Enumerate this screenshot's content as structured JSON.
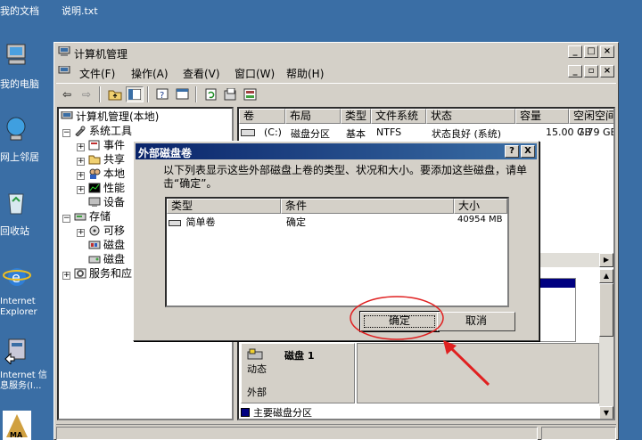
{
  "desktop": {
    "items": [
      {
        "label": "我的文档",
        "icon": "folder-icon"
      },
      {
        "label": "说明.txt",
        "icon": "text-file-icon"
      },
      {
        "label": "我的电脑",
        "icon": "computer-icon"
      },
      {
        "label": "网上邻居",
        "icon": "network-icon"
      },
      {
        "label": "回收站",
        "icon": "recycle-bin-icon"
      },
      {
        "label": "Internet Explorer",
        "icon": "ie-icon"
      },
      {
        "label": "Internet 信息服务(I...",
        "icon": "iis-icon"
      }
    ]
  },
  "window": {
    "title": "计算机管理",
    "menu": [
      "文件(F)",
      "操作(A)",
      "查看(V)",
      "窗口(W)",
      "帮助(H)"
    ],
    "tree": [
      {
        "label": "计算机管理(本地)",
        "indent": 0
      },
      {
        "label": "系统工具",
        "indent": 1
      },
      {
        "label": "事件",
        "indent": 2
      },
      {
        "label": "共享",
        "indent": 2
      },
      {
        "label": "本地",
        "indent": 2
      },
      {
        "label": "性能",
        "indent": 2
      },
      {
        "label": "设备",
        "indent": 2
      },
      {
        "label": "存储",
        "indent": 1
      },
      {
        "label": "可移",
        "indent": 2
      },
      {
        "label": "磁盘",
        "indent": 2
      },
      {
        "label": "磁盘",
        "indent": 2
      },
      {
        "label": "服务和应",
        "indent": 1
      }
    ],
    "volume_columns": [
      "卷",
      "布局",
      "类型",
      "文件系统",
      "状态",
      "容量",
      "空闲空间"
    ],
    "volume_row": [
      "(C:)",
      "磁盘分区",
      "基本",
      "NTFS",
      "状态良好 (系统)",
      "15.00 GB",
      "7.79 GB"
    ],
    "disk": {
      "name": "磁盘 1",
      "type": "动态",
      "location": "外部"
    },
    "legend": "主要磁盘分区"
  },
  "dialog": {
    "title": "外部磁盘卷",
    "help": "?",
    "close": "X",
    "description": "以下列表显示这些外部磁盘上卷的类型、状况和大小。要添加这些磁盘，请单击“确定”。",
    "columns": [
      "类型",
      "条件",
      "大小"
    ],
    "rows": [
      {
        "type": "简单卷",
        "condition": "确定",
        "size": "40954 MB"
      }
    ],
    "ok": "确定",
    "cancel": "取消"
  },
  "annotation": {
    "color": "#e02020"
  }
}
